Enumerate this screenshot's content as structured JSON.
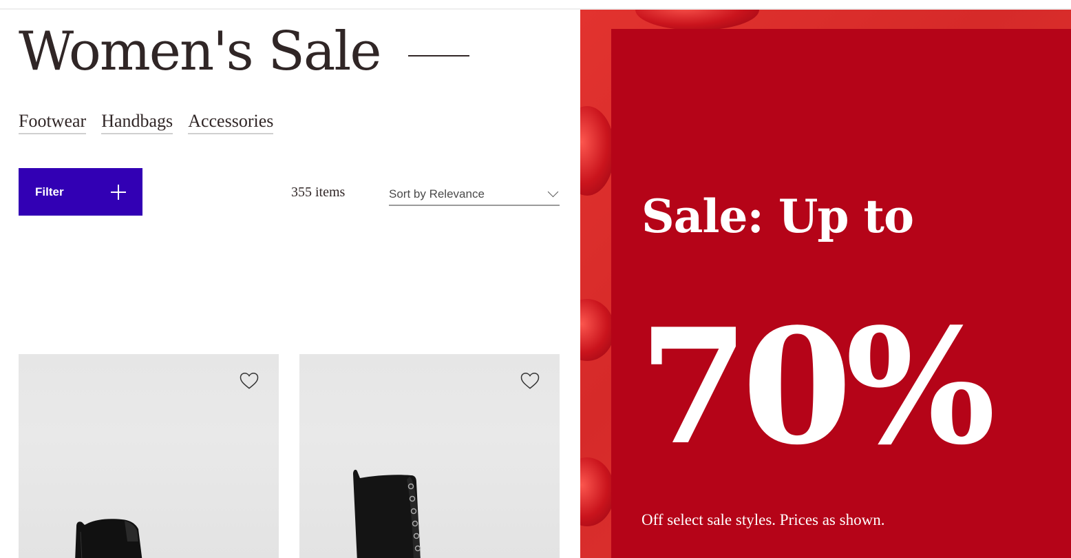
{
  "header": {
    "title": "Women's Sale"
  },
  "categories": [
    {
      "label": "Footwear"
    },
    {
      "label": "Handbags"
    },
    {
      "label": "Accessories"
    }
  ],
  "toolbar": {
    "filter_label": "Filter",
    "item_count": "355 items",
    "sort_label": "Sort by Relevance"
  },
  "products": [
    {
      "image": "black-chelsea-boot",
      "favorite_icon": "heart-icon"
    },
    {
      "image": "black-lace-up-combat-boot",
      "favorite_icon": "heart-icon"
    }
  ],
  "promo": {
    "headline": "Sale: Up to",
    "discount": "70%",
    "subtext": "Off select sale styles. Prices as shown."
  },
  "colors": {
    "filter_button": "#3200b4",
    "promo_panel": "#b50418",
    "promo_background": "#e2332f",
    "text_dark": "#302626"
  }
}
